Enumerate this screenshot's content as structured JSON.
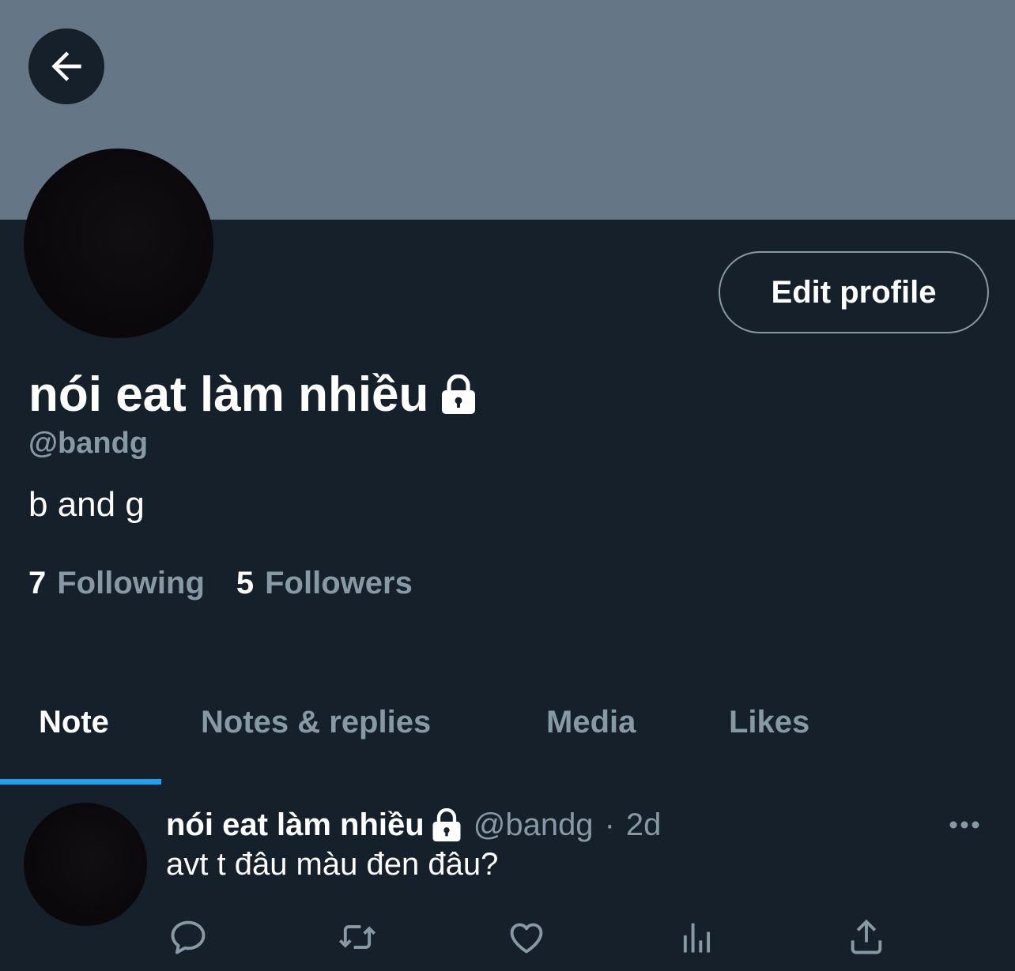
{
  "header": {
    "back_icon": "arrow-left-icon",
    "banner_color": "#657786"
  },
  "profile": {
    "display_name": "nói eat làm nhiều",
    "lock_icon": "lock-icon",
    "handle": "@bandg",
    "bio": "b and g",
    "edit_button_label": "Edit profile",
    "following_count": "7",
    "following_label": "Following",
    "followers_count": "5",
    "followers_label": "Followers"
  },
  "tabs": [
    {
      "label": "Note",
      "active": true
    },
    {
      "label": "Notes & replies",
      "active": false
    },
    {
      "label": "Media",
      "active": false
    },
    {
      "label": "Likes",
      "active": false
    }
  ],
  "tweet": {
    "name": "nói eat làm nhiều",
    "handle": "@bandg",
    "separator": "·",
    "time": "2d",
    "text": "avt t đâu màu đen đâu?",
    "more_icon": "more-horizontal-icon",
    "actions": [
      "reply-icon",
      "retweet-icon",
      "like-icon",
      "analytics-icon",
      "share-icon"
    ]
  },
  "colors": {
    "background": "#15202b",
    "secondary_text": "#8899a6",
    "accent": "#1da1f2"
  }
}
